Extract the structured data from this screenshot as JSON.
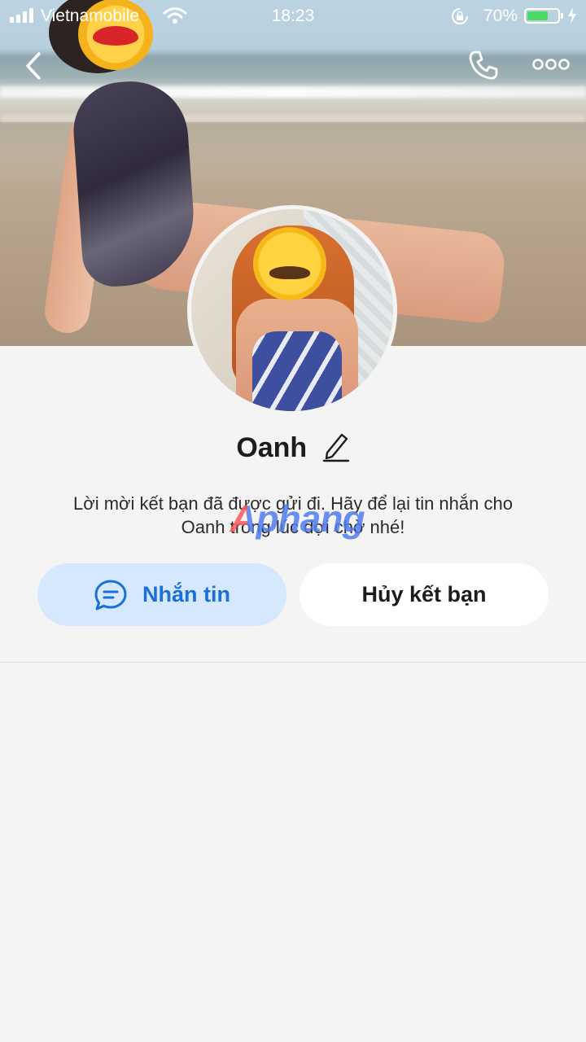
{
  "status_bar": {
    "carrier": "Vietnamobile",
    "time": "18:23",
    "battery_percent": "70%",
    "battery_level": 0.7,
    "battery_color": "#4cd964",
    "icons": [
      "signal-icon",
      "wifi-icon",
      "rotation-lock-icon",
      "battery-icon",
      "charging-bolt-icon"
    ]
  },
  "header": {
    "back_icon": "chevron-left-icon",
    "call_icon": "phone-icon",
    "more_icon": "more-dots-icon"
  },
  "profile": {
    "name": "Oanh",
    "edit_icon": "pencil-icon",
    "message_line1": "Lời mời kết bạn đã được gửi đi. Hãy để lại tin nhắn cho",
    "message_line2": "Oanh trong lúc đợi chờ nhé!"
  },
  "actions": {
    "message_label": "Nhắn tin",
    "message_icon": "chat-bubble-icon",
    "unfriend_label": "Hủy kết bạn"
  },
  "watermark": "Aphang",
  "colors": {
    "accent": "#1a6fd8",
    "accent_bg": "#d6e8fd",
    "background": "#f4f4f5"
  }
}
